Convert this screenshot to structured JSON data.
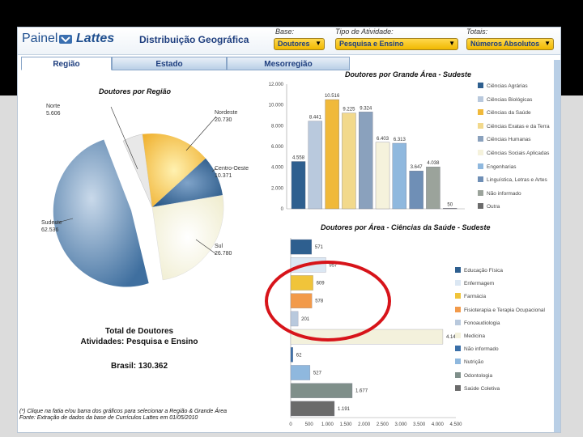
{
  "header": {
    "logo_text_1": "Painel",
    "logo_text_2": "Lattes",
    "title": "Distribuição Geográfica",
    "base_label": "Base:",
    "base_value": "Doutores",
    "tipo_label": "Tipo de Atividade:",
    "tipo_value": "Pesquisa e Ensino",
    "totais_label": "Totais:",
    "totais_value": "Números Absolutos"
  },
  "tabs": [
    {
      "label": "Região",
      "active": true
    },
    {
      "label": "Estado",
      "active": false
    },
    {
      "label": "Mesorregião",
      "active": false
    }
  ],
  "pie": {
    "title": "Doutores por Região",
    "labels": [
      {
        "name": "Norte",
        "value": "5.606"
      },
      {
        "name": "Nordeste",
        "value": "20.730"
      },
      {
        "name": "Centro-Oeste",
        "value": "10.371"
      },
      {
        "name": "Sul",
        "value": "26.780"
      },
      {
        "name": "Sudeste",
        "value": "62.536"
      }
    ]
  },
  "totals": {
    "title_line1": "Total de Doutores",
    "title_line2": "Atividades: Pesquisa e Ensino",
    "brasil": "Brasil: 130.362"
  },
  "footnote": {
    "line1": "(*) Clique na fatia e/ou barra dos gráficos para selecionar a Região & Grande Área",
    "line2": "Fonte: Extração de dados da base de Currículos Lattes em 01/05/2010"
  },
  "chart_data": [
    {
      "type": "bar",
      "title": "Doutores por Grande Área - Sudeste",
      "categories": [
        "Ciências Agrárias",
        "Ciências Biológicas",
        "Ciências da Saúde",
        "Ciências Exatas e da Terra",
        "Ciências Humanas",
        "Ciências Sociais Aplicadas",
        "Engenharias",
        "Linguística, Letras e Artes",
        "Não informado",
        "Outra"
      ],
      "values": [
        4558,
        8441,
        10516,
        9225,
        9324,
        6403,
        6313,
        3647,
        4038,
        50
      ],
      "value_labels": [
        "4.558",
        "8.441",
        "10.516",
        "9.225",
        "9.324",
        "6.403",
        "6.313",
        "3.647",
        "4.038",
        "50"
      ],
      "colors": [
        "#2e5f8f",
        "#b9c9dd",
        "#f0b93a",
        "#f2d98c",
        "#8aa1bd",
        "#f5f2dc",
        "#8fb8de",
        "#6f8fb6",
        "#9ba39b",
        "#6b6b6b"
      ],
      "ylim": [
        0,
        12000
      ],
      "ticks": [
        "0",
        "2.000",
        "4.000",
        "6.000",
        "8.000",
        "10.000",
        "12.000"
      ],
      "legend_position": "right"
    },
    {
      "type": "bar",
      "orientation": "horizontal",
      "title": "Doutores por Área - Ciências da Saúde - Sudeste",
      "categories": [
        "Educação Física",
        "Enfermagem",
        "Farmácia",
        "Fisioterapia e Terapia Ocupacional",
        "Fonoaudiologia",
        "Medicina",
        "Não informado",
        "Nutrição",
        "Odontologia",
        "Saúde Coletiva"
      ],
      "values": [
        571,
        957,
        609,
        578,
        201,
        4146,
        62,
        527,
        1677,
        1191
      ],
      "value_labels": [
        "571",
        "957",
        "609",
        "578",
        "201",
        "4.146",
        "62",
        "527",
        "1.677",
        "1.191"
      ],
      "colors": [
        "#2e5f8f",
        "#dbe7f3",
        "#f0c43a",
        "#f29a4a",
        "#b9c9dd",
        "#f3f1dc",
        "#3a6fa8",
        "#8fb8de",
        "#7f8f8a",
        "#6b6b6b"
      ],
      "xlim": [
        0,
        4500
      ],
      "ticks": [
        "0",
        "500",
        "1.000",
        "1.500",
        "2.000",
        "2.500",
        "3.000",
        "3.500",
        "4.000",
        "4.500"
      ],
      "legend_position": "right"
    }
  ]
}
